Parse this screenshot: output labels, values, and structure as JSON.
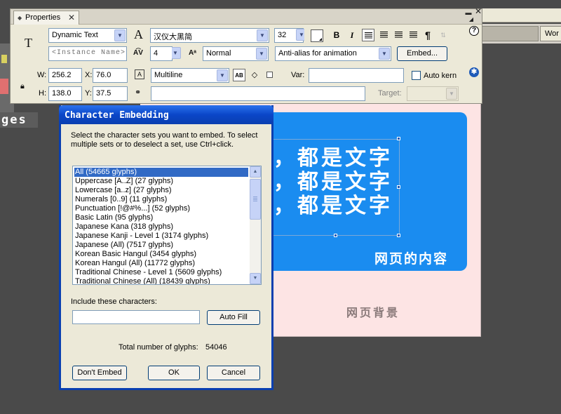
{
  "background": {
    "pages_label": "ges",
    "right_toolbar_label": "Wor",
    "stage": {
      "text_lines": [
        "，都是文字",
        "，都是文字",
        "，都是文字"
      ],
      "blue_caption": "网页的内容",
      "pink_caption": "网页背景"
    }
  },
  "properties": {
    "tab_label": "Properties",
    "tool_icon": "T",
    "text_type": "Dynamic Text",
    "instance_placeholder": "<Instance Name>",
    "font_family": "汉仪大黑简",
    "font_size": "32",
    "letter_spacing": "4",
    "baseline": "Normal",
    "anti_alias": "Anti-alias for animation",
    "embed_button": "Embed...",
    "bold_icon": "B",
    "italic_icon": "I",
    "paragraph_icon": "¶",
    "line_type": "Multiline",
    "var_label": "Var:",
    "var_value": "",
    "auto_kern_label": "Auto kern",
    "target_label": "Target:",
    "url_value": "",
    "w_label": "W:",
    "w_value": "256.2",
    "h_label": "H:",
    "h_value": "138.0",
    "x_label": "X:",
    "x_value": "76.0",
    "y_label": "Y:",
    "y_value": "37.5",
    "help_icon": "?",
    "accessibility_icon": "✱"
  },
  "dialog": {
    "title": "Character Embedding",
    "instructions": "Select the character sets you want to embed. To select multiple sets or to deselect a set, use Ctrl+click.",
    "character_sets": [
      "All  (54665 glyphs)",
      "Uppercase [A..Z]  (27 glyphs)",
      "Lowercase [a..z]  (27 glyphs)",
      "Numerals [0..9]  (11 glyphs)",
      "Punctuation [!@#%...]  (52 glyphs)",
      "Basic Latin  (95 glyphs)",
      "Japanese Kana  (318 glyphs)",
      "Japanese Kanji - Level 1 (3174 glyphs)",
      "Japanese (All)  (7517 glyphs)",
      "Korean Basic Hangul (3454 glyphs)",
      "Korean Hangul (All) (11772 glyphs)",
      "Traditional Chinese - Level 1 (5609 glyphs)",
      "Traditional Chinese (All)  (18439 glyphs)"
    ],
    "selected_index": 0,
    "include_label": "Include these characters:",
    "include_value": "",
    "auto_fill_button": "Auto Fill",
    "total_label": "Total number of glyphs:",
    "total_value": "54046",
    "dont_embed_button": "Don't Embed",
    "ok_button": "OK",
    "cancel_button": "Cancel"
  },
  "colors": {
    "blue_panel": "#1a8cf0",
    "stage_pink": "#fde4e4",
    "dialog_frame": "#0a3fb0",
    "selection": "#316ac5"
  }
}
